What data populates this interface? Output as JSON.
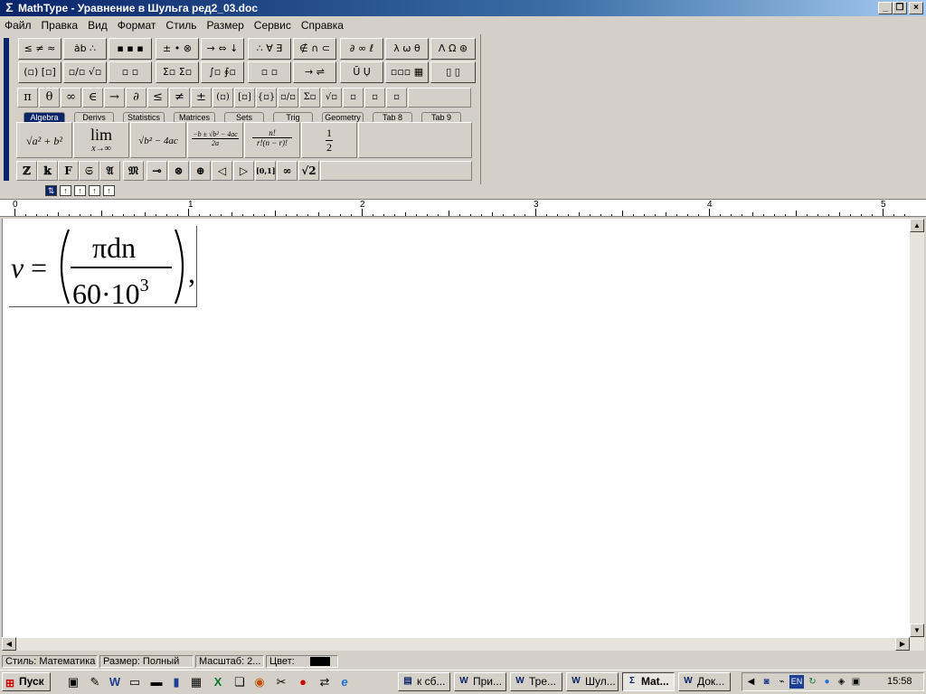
{
  "window": {
    "title": "MathType - Уравнение в Шульга ред2_03.doc",
    "app_icon": "sigma-icon",
    "min": "_",
    "max": "❐",
    "close": "×"
  },
  "menu": [
    "Файл",
    "Правка",
    "Вид",
    "Формат",
    "Стиль",
    "Размер",
    "Сервис",
    "Справка"
  ],
  "palette_row1": [
    "≤ ≠ ≈",
    "ȧb ∴",
    "▪ ▪ ▪",
    "± • ⊗",
    "→ ⇔ ↓",
    "∴ ∀ ∃",
    "∉ ∩ ⊂",
    "∂ ∞ ℓ",
    "λ ω θ",
    "Λ Ω ⊛"
  ],
  "palette_row2": [
    "(▫) [▫]",
    "▫/▫ √▫",
    "▫ ▫",
    "Σ▫ Σ▫",
    "∫▫ ∮▫",
    "▫ ▫",
    "→ ⇌",
    "Ū Ụ",
    "▫▫▫ ▦",
    "▯ ▯"
  ],
  "symbol_row": [
    "π",
    "θ",
    "∞",
    "∈",
    "→",
    "∂",
    "≤",
    "≠",
    "±",
    "(▫)",
    "[▫]",
    "{▫}",
    "▫/▫",
    "Σ▫",
    "√▫",
    "▫",
    "▫",
    "▫"
  ],
  "tabs": [
    "Algebra",
    "Derivs",
    "Statistics",
    "Matrices",
    "Sets",
    "Trig",
    "Geometry",
    "Tab 8",
    "Tab 9"
  ],
  "templates": {
    "t1": "√a² + b²",
    "lim": "lim",
    "lim_sub": "x→∞",
    "t3": "√b² − 4ac",
    "t4_num": "−b ± √b² − 4ac",
    "t4_den": "2a",
    "t5_num": "n!",
    "t5_den": "r!(n − r)!",
    "t6_num": "1",
    "t6_den": "2"
  },
  "style_row": [
    "ℤ",
    "𝕜",
    "𝐅",
    "𝔖",
    "𝔄",
    "𝔐",
    "⊸",
    "⊗",
    "⊕",
    "◁",
    "▷",
    "[0,1]",
    "∞",
    "√2"
  ],
  "mini_buttons": [
    "⇅",
    "↑",
    "↑",
    "↑",
    "↑"
  ],
  "ruler": [
    "0",
    "1",
    "2",
    "3",
    "4",
    "5"
  ],
  "equation": {
    "lhs": "v",
    "equals": "=",
    "numerator": "πdn",
    "den_base": "60·10",
    "den_exp": "3",
    "comma": ","
  },
  "status": {
    "style": "Стиль: Математика",
    "size": "Размер: Полный",
    "zoom": "Масштаб: 2...",
    "color_label": "Цвет:",
    "color_value": "#000000"
  },
  "taskbar": {
    "start": "Пуск",
    "tasks": [
      "к сб...",
      "При...",
      "Тре...",
      "Шул...",
      "Mat...",
      "Док..."
    ],
    "task_icons": [
      "folder-icon",
      "word-icon",
      "word-icon",
      "word-icon",
      "sigma-icon",
      "word-icon"
    ],
    "lang": "EN",
    "clock": "15:58"
  }
}
